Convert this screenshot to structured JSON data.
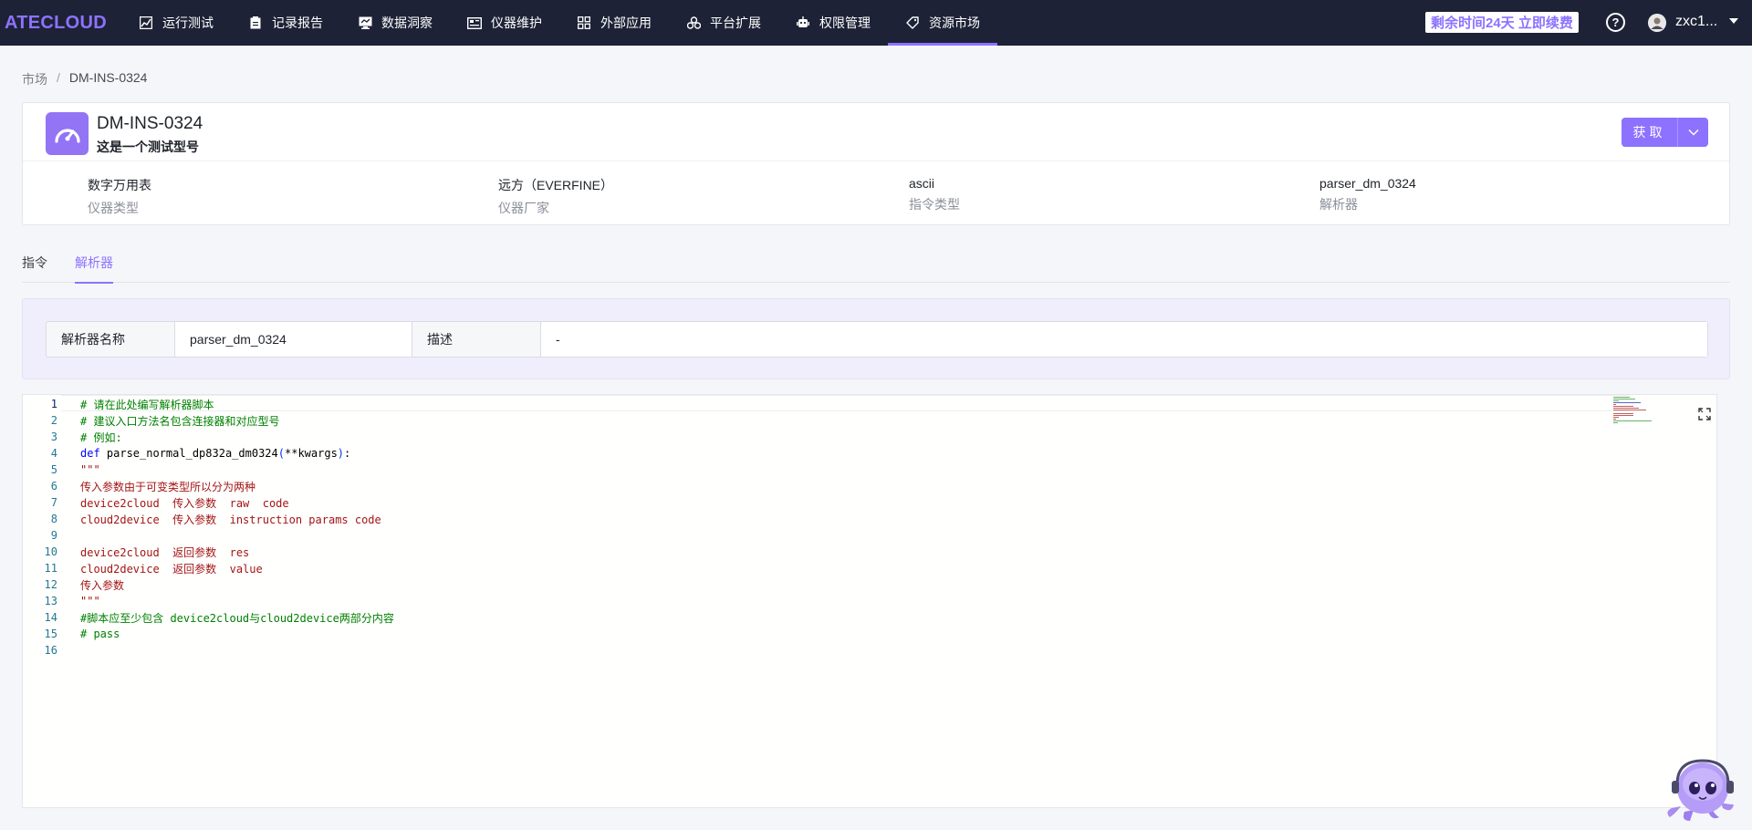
{
  "app": {
    "logo": "ATECLOUD"
  },
  "nav": {
    "items": [
      {
        "label": "运行测试",
        "icon": "chart-icon"
      },
      {
        "label": "记录报告",
        "icon": "clipboard-icon"
      },
      {
        "label": "数据洞察",
        "icon": "monitor-icon"
      },
      {
        "label": "仪器维护",
        "icon": "instrument-icon"
      },
      {
        "label": "外部应用",
        "icon": "grid-icon"
      },
      {
        "label": "平台扩展",
        "icon": "cluster-icon"
      },
      {
        "label": "权限管理",
        "icon": "robot-icon"
      },
      {
        "label": "资源市场",
        "icon": "tag-icon",
        "active": true
      }
    ],
    "renew": "剩余时间24天 立即续费",
    "help": "?",
    "user": "zxc1..."
  },
  "breadcrumb": {
    "root": "市场",
    "sep": "/",
    "current": "DM-INS-0324"
  },
  "header": {
    "title": "DM-INS-0324",
    "description": "这是一个测试型号",
    "get_label": "获取",
    "meta": [
      {
        "value": "数字万用表",
        "label": "仪器类型"
      },
      {
        "value": "远方（EVERFINE）",
        "label": "仪器厂家"
      },
      {
        "value": "ascii",
        "label": "指令类型"
      },
      {
        "value": "parser_dm_0324",
        "label": "解析器"
      }
    ]
  },
  "tabs": [
    {
      "label": "指令"
    },
    {
      "label": "解析器",
      "active": true
    }
  ],
  "parser_info": {
    "name_key": "解析器名称",
    "name_value": "parser_dm_0324",
    "desc_key": "描述",
    "desc_value": "-"
  },
  "editor": {
    "line_numbers": [
      "1",
      "2",
      "3",
      "4",
      "5",
      "6",
      "7",
      "8",
      "9",
      "10",
      "11",
      "12",
      "13",
      "14",
      "15",
      "16"
    ],
    "lines": [
      "# 请在此处编写解析器脚本",
      "# 建议入口方法名包含连接器和对应型号",
      "# 例如:",
      "def parse_normal_dp832a_dm0324(**kwargs):",
      "\"\"\"",
      "传入参数由于可变类型所以分为两种",
      "device2cloud  传入参数  raw  code",
      "cloud2device  传入参数  instruction params code",
      "",
      "device2cloud  返回参数  res",
      "cloud2device  返回参数  value",
      "传入参数",
      "\"\"\"",
      "#脚本应至少包含 device2cloud与cloud2device两部分内容",
      "# pass",
      ""
    ],
    "def_keyword": "def",
    "def_name": " parse_normal_dp832a_dm0324",
    "def_open": "(",
    "def_args": "**kwargs",
    "def_close": ")",
    "def_colon": ":"
  },
  "colors": {
    "accent": "#8d72ff",
    "nav_bg": "#1d2236",
    "comment": "#008000",
    "string": "#a31515",
    "keyword": "#0000ff"
  }
}
